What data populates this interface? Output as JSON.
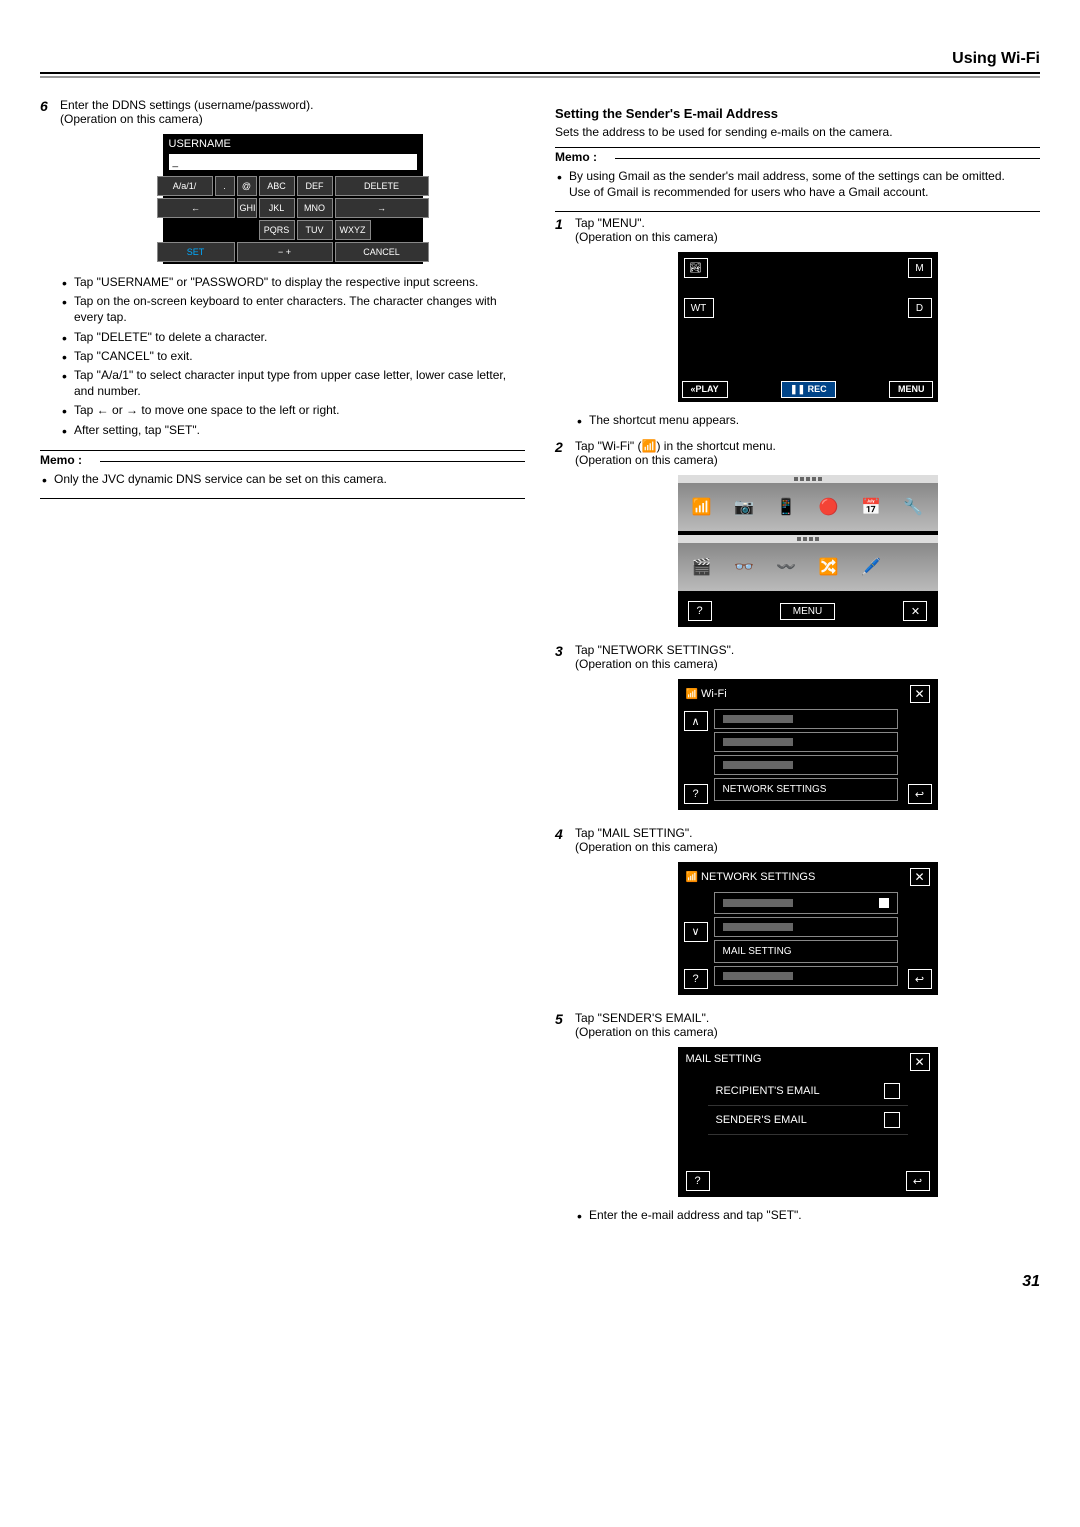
{
  "header": "Using Wi-Fi",
  "page_number": "31",
  "left": {
    "step6": {
      "num": "6",
      "text1": "Enter the DDNS settings (username/password).",
      "text2": "(Operation on this camera)"
    },
    "keyboard": {
      "title": "USERNAME",
      "cursor": "_",
      "row1": [
        "A/a/1/",
        ".",
        "@",
        "ABC",
        "DEF",
        "DELETE"
      ],
      "row2": [
        "←",
        "GHI",
        "JKL",
        "MNO",
        "→"
      ],
      "row3": [
        "PQRS",
        "TUV",
        "WXYZ"
      ],
      "row4": [
        "SET",
        "− +",
        "CANCEL"
      ]
    },
    "bullets": [
      "Tap \"USERNAME\" or \"PASSWORD\" to display the respective input screens.",
      "Tap on the on-screen keyboard to enter characters. The character changes with every tap.",
      "Tap \"DELETE\" to delete a character.",
      "Tap \"CANCEL\" to exit.",
      "Tap \"A/a/1\" to select character input type from upper case letter, lower case letter, and number.",
      "Tap ← or → to move one space to the left or right.",
      "After setting, tap \"SET\"."
    ],
    "memo_label": "Memo :",
    "memo_bullets": [
      "Only the JVC dynamic DNS service can be set on this camera."
    ]
  },
  "right": {
    "section_title": "Setting the Sender's E-mail Address",
    "section_sub": "Sets the address to be used for sending e-mails on the camera.",
    "memo_label": "Memo :",
    "memo_bullets": [
      "By using Gmail as the sender's mail address, some of the settings can be omitted.",
      "Use of Gmail is recommended for users who have a Gmail account."
    ],
    "step1": {
      "num": "1",
      "text1": "Tap \"MENU\".",
      "text2": "(Operation on this camera)",
      "bullet": "The shortcut menu appears.",
      "cam": {
        "WT": "WT",
        "M": "M",
        "D": "D",
        "play": "«PLAY",
        "rec": "REC",
        "menu": "MENU"
      }
    },
    "step2": {
      "num": "2",
      "text1": "Tap \"Wi-Fi\" (📶) in the shortcut menu.",
      "text2": "(Operation on this camera)",
      "menu_label": "MENU"
    },
    "step3": {
      "num": "3",
      "text1": "Tap \"NETWORK SETTINGS\".",
      "text2": "(Operation on this camera)",
      "title": "Wi-Fi",
      "item": "NETWORK SETTINGS"
    },
    "step4": {
      "num": "4",
      "text1": "Tap \"MAIL SETTING\".",
      "text2": "(Operation on this camera)",
      "title": "NETWORK SETTINGS",
      "item": "MAIL SETTING"
    },
    "step5": {
      "num": "5",
      "text1": "Tap \"SENDER'S EMAIL\".",
      "text2": "(Operation on this camera)",
      "title": "MAIL SETTING",
      "row1": "RECIPIENT'S EMAIL",
      "row2": "SENDER'S EMAIL",
      "bullet": "Enter the e-mail address and tap \"SET\"."
    }
  }
}
